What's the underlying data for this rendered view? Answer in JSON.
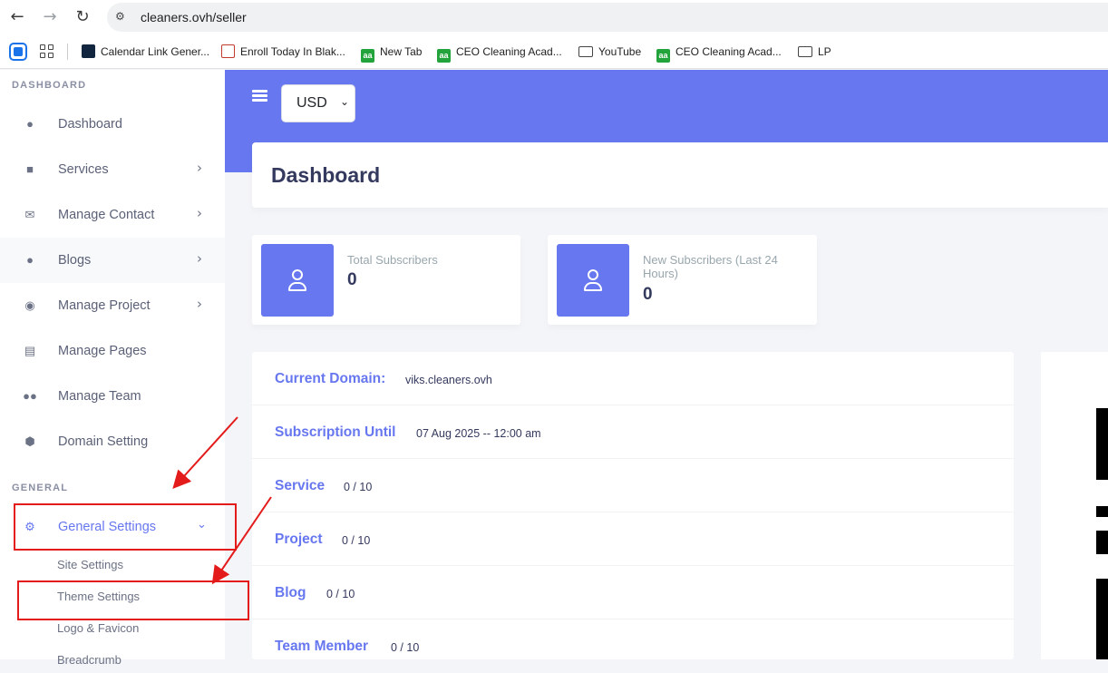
{
  "browser": {
    "url": "cleaners.ovh/seller",
    "bookmarks": [
      {
        "label": "Calendar Link Gener..."
      },
      {
        "label": "Enroll Today In Blak..."
      },
      {
        "label": "New Tab"
      },
      {
        "label": "CEO Cleaning Acad..."
      },
      {
        "label": "YouTube"
      },
      {
        "label": "CEO Cleaning Acad..."
      },
      {
        "label": "LP"
      }
    ]
  },
  "sidebar": {
    "section_dashboard": "DASHBOARD",
    "section_general": "GENERAL",
    "items": [
      {
        "label": "Dashboard",
        "icon": "fire-icon"
      },
      {
        "label": "Services",
        "icon": "toolbox-icon"
      },
      {
        "label": "Manage Contact",
        "icon": "mail-bulk-icon"
      },
      {
        "label": "Blogs",
        "icon": "blog-icon"
      },
      {
        "label": "Manage Project",
        "icon": "eye-icon"
      },
      {
        "label": "Manage Pages",
        "icon": "file-icon"
      },
      {
        "label": "Manage Team",
        "icon": "users-icon"
      },
      {
        "label": "Domain Setting",
        "icon": "globe-icon"
      }
    ],
    "general_settings": {
      "label": "General Settings",
      "icon": "gear-icon"
    },
    "sub_items": [
      "Site Settings",
      "Theme Settings",
      "Logo & Favicon",
      "Breadcrumb"
    ]
  },
  "header": {
    "currency": "USD",
    "page_title": "Dashboard"
  },
  "stats": [
    {
      "label": "Total Subscribers",
      "value": "0"
    },
    {
      "label": "New Subscribers (Last 24 Hours)",
      "value": "0"
    }
  ],
  "info": [
    {
      "label": "Current Domain:",
      "value": "viks.cleaners.ovh"
    },
    {
      "label": "Subscription Until",
      "value": "07 Aug 2025 -- 12:00 am"
    },
    {
      "label": "Service",
      "value": "0 / 10"
    },
    {
      "label": "Project",
      "value": "0 / 10"
    },
    {
      "label": "Blog",
      "value": "0 / 10"
    },
    {
      "label": "Team Member",
      "value": "0 / 10"
    }
  ],
  "colors": {
    "accent": "#6777ef",
    "annotation": "#e31b1b"
  }
}
